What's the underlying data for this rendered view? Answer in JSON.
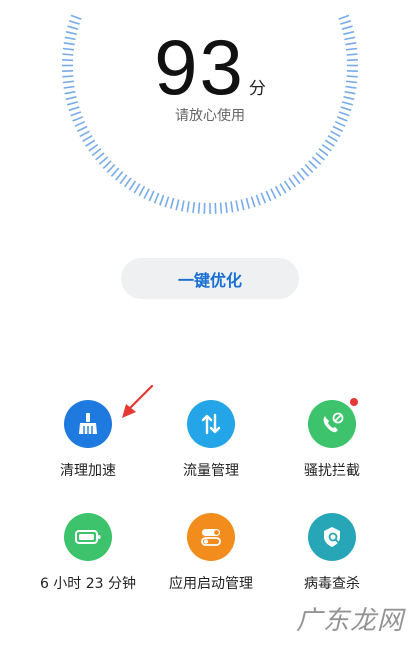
{
  "score": {
    "value": "93",
    "unit": "分",
    "status": "请放心使用"
  },
  "optimize_button": "一键优化",
  "tools": [
    {
      "label": "清理加速",
      "icon": "broom-icon",
      "color": "#1f7ae0"
    },
    {
      "label": "流量管理",
      "icon": "data-arrows-icon",
      "color": "#23a5e8"
    },
    {
      "label": "骚扰拦截",
      "icon": "phone-block-icon",
      "color": "#3cc36b",
      "badge": true
    },
    {
      "label": "6 小时 23 分钟",
      "icon": "battery-icon",
      "color": "#3cc36b"
    },
    {
      "label": "应用启动管理",
      "icon": "app-launch-toggle-icon",
      "color": "#f28c1c"
    },
    {
      "label": "病毒查杀",
      "icon": "virus-scan-icon",
      "color": "#27a6b8"
    }
  ],
  "watermark": "广东龙网",
  "colors": {
    "accent": "#1a6fd3",
    "ring": "#4a90e2",
    "arrow": "#e53935"
  }
}
